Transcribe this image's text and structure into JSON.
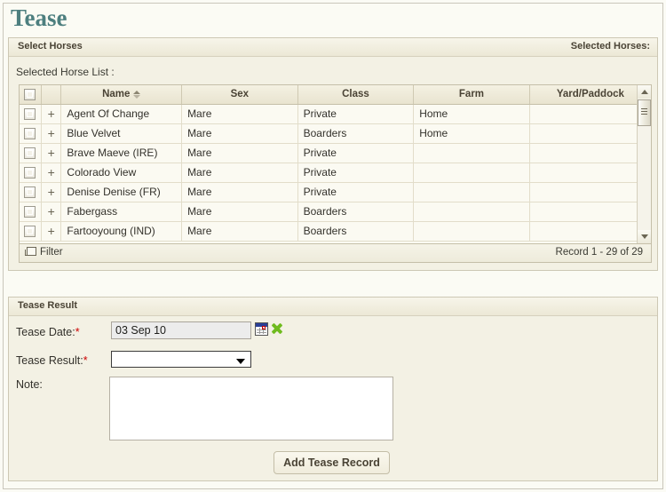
{
  "page": {
    "title": "Tease"
  },
  "select_horses_panel": {
    "header_left": "Select Horses",
    "header_right": "Selected Horses:",
    "list_label": "Selected Horse List :"
  },
  "grid": {
    "columns": [
      "",
      "",
      "Name",
      "Sex",
      "Class",
      "Farm",
      "Yard/Paddock"
    ],
    "sort_column": "Name",
    "sort_direction": "none",
    "rows": [
      {
        "name": "Agent Of Change",
        "sex": "Mare",
        "class": "Private",
        "farm": "Home",
        "yard": ""
      },
      {
        "name": "Blue Velvet",
        "sex": "Mare",
        "class": "Boarders",
        "farm": "Home",
        "yard": ""
      },
      {
        "name": "Brave Maeve (IRE)",
        "sex": "Mare",
        "class": "Private",
        "farm": "",
        "yard": ""
      },
      {
        "name": "Colorado View",
        "sex": "Mare",
        "class": "Private",
        "farm": "",
        "yard": ""
      },
      {
        "name": "Denise Denise (FR)",
        "sex": "Mare",
        "class": "Private",
        "farm": "",
        "yard": ""
      },
      {
        "name": "Fabergass",
        "sex": "Mare",
        "class": "Boarders",
        "farm": "",
        "yard": ""
      },
      {
        "name": "Fartooyoung (IND)",
        "sex": "Mare",
        "class": "Boarders",
        "farm": "",
        "yard": ""
      }
    ],
    "expand_glyph": "+",
    "footer": {
      "filter_label": "Filter",
      "record_label": "Record 1 - 29 of 29"
    }
  },
  "tease_result_panel": {
    "header_left": "Tease Result",
    "fields": {
      "date_label": "Tease Date:",
      "date_value": "03 Sep 10",
      "result_label": "Tease Result:",
      "result_value": "",
      "note_label": "Note:",
      "note_value": "",
      "required_marker": "*"
    },
    "submit_label": "Add Tease Record"
  },
  "colors": {
    "title": "#4d7f7f",
    "panel_bg": "#f3f1e4",
    "panel_border": "#cdc8b4",
    "grid_row_bg": "#fbfaf2",
    "required": "#cc0000",
    "calendar_header": "#2a3f96",
    "clear_icon": "#6fbb1e"
  }
}
